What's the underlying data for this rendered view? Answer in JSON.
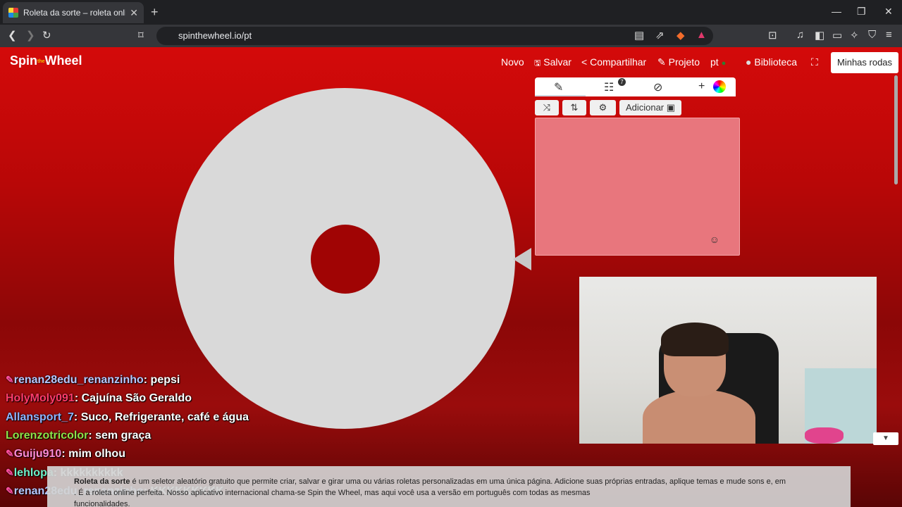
{
  "browser": {
    "tab_title": "Roleta da sorte – roleta online g",
    "url": "spinthewheel.io/pt"
  },
  "site": {
    "logo_text": "Spin",
    "logo_small": "the",
    "logo_text2": "Wheel",
    "nav": {
      "novo": "Novo",
      "salvar": "Salvar",
      "compartilhar": "Compartilhar",
      "projeto": "Projeto",
      "lang": "pt",
      "biblioteca": "Biblioteca",
      "minhas_rodas": "Minhas rodas"
    },
    "editor": {
      "adicionar_label": "Adicionar",
      "entries_badge": "7"
    }
  },
  "chat": [
    {
      "user": "renan28edu_renanzinho",
      "message": ": pepsi",
      "color": "#b7c7ff",
      "badge": true
    },
    {
      "user": "HolyMoly091",
      "message": ": Cajuína São Geraldo",
      "color": "#ff3b6b",
      "badge": false
    },
    {
      "user": "Allansport_7",
      "message": ": Suco, Refrigerante, café e água",
      "color": "#8fb4ff",
      "badge": false
    },
    {
      "user": "Lorenzotricolor",
      "message": ": sem graça",
      "color": "#8fe34a",
      "badge": false
    },
    {
      "user": "Guiju910",
      "message": ": mim olhou",
      "color": "#ff8bd6",
      "badge": true
    },
    {
      "user": "lehlopa",
      "message": ": kkkkkkkkkk",
      "color": "#6ff0c8",
      "badge": true
    },
    {
      "user": "renan28edu_renanzinho",
      "message": ": KKKKKKKKK",
      "color": "#b7c7ff",
      "badge": true
    }
  ],
  "footer": {
    "bold": "Roleta da sorte",
    "line1": " é um seletor aleatório gratuito que permite criar, salvar e girar uma ou várias roletas personalizadas em uma única página. Adicione suas próprias entradas, aplique temas e mude sons e, em",
    "line2": ". É a roleta online perfeita. Nosso aplicativo internacional chama-se Spin the Wheel, mas aqui você usa a versão em português com todas as mesmas",
    "line3": "funcionalidades."
  }
}
